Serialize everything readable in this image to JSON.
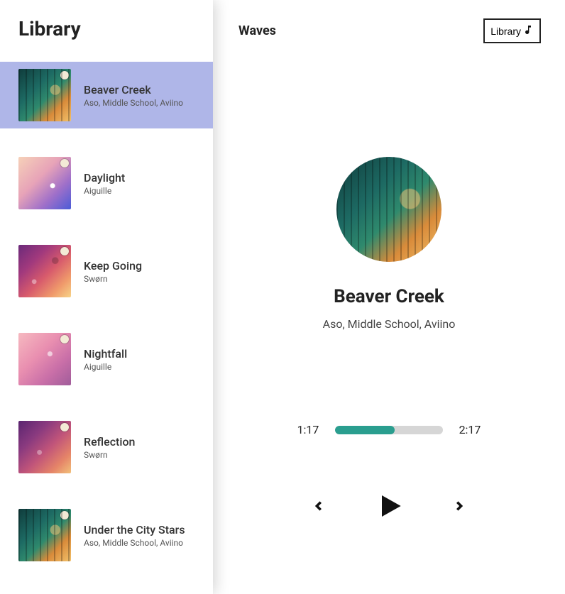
{
  "sidebar": {
    "title": "Library",
    "songs": [
      {
        "title": "Beaver Creek",
        "artist": "Aso, Middle School, Aviino",
        "art": "art-forest",
        "selected": true
      },
      {
        "title": "Daylight",
        "artist": "Aiguille",
        "art": "art-daylight",
        "selected": false
      },
      {
        "title": "Keep Going",
        "artist": "Swørn",
        "art": "art-sworn",
        "selected": false
      },
      {
        "title": "Nightfall",
        "artist": "Aiguille",
        "art": "art-nightfall",
        "selected": false
      },
      {
        "title": "Reflection",
        "artist": "Swørn",
        "art": "art-reflection",
        "selected": false
      },
      {
        "title": "Under the City Stars",
        "artist": "Aso, Middle School, Aviino",
        "art": "art-forest",
        "selected": false
      }
    ]
  },
  "player": {
    "brand": "Waves",
    "library_button_label": "Library",
    "now_playing": {
      "title": "Beaver Creek",
      "artist": "Aso, Middle School, Aviino",
      "art": "art-forest"
    },
    "progress": {
      "current": "1:17",
      "duration": "2:17",
      "percent": 55
    }
  }
}
